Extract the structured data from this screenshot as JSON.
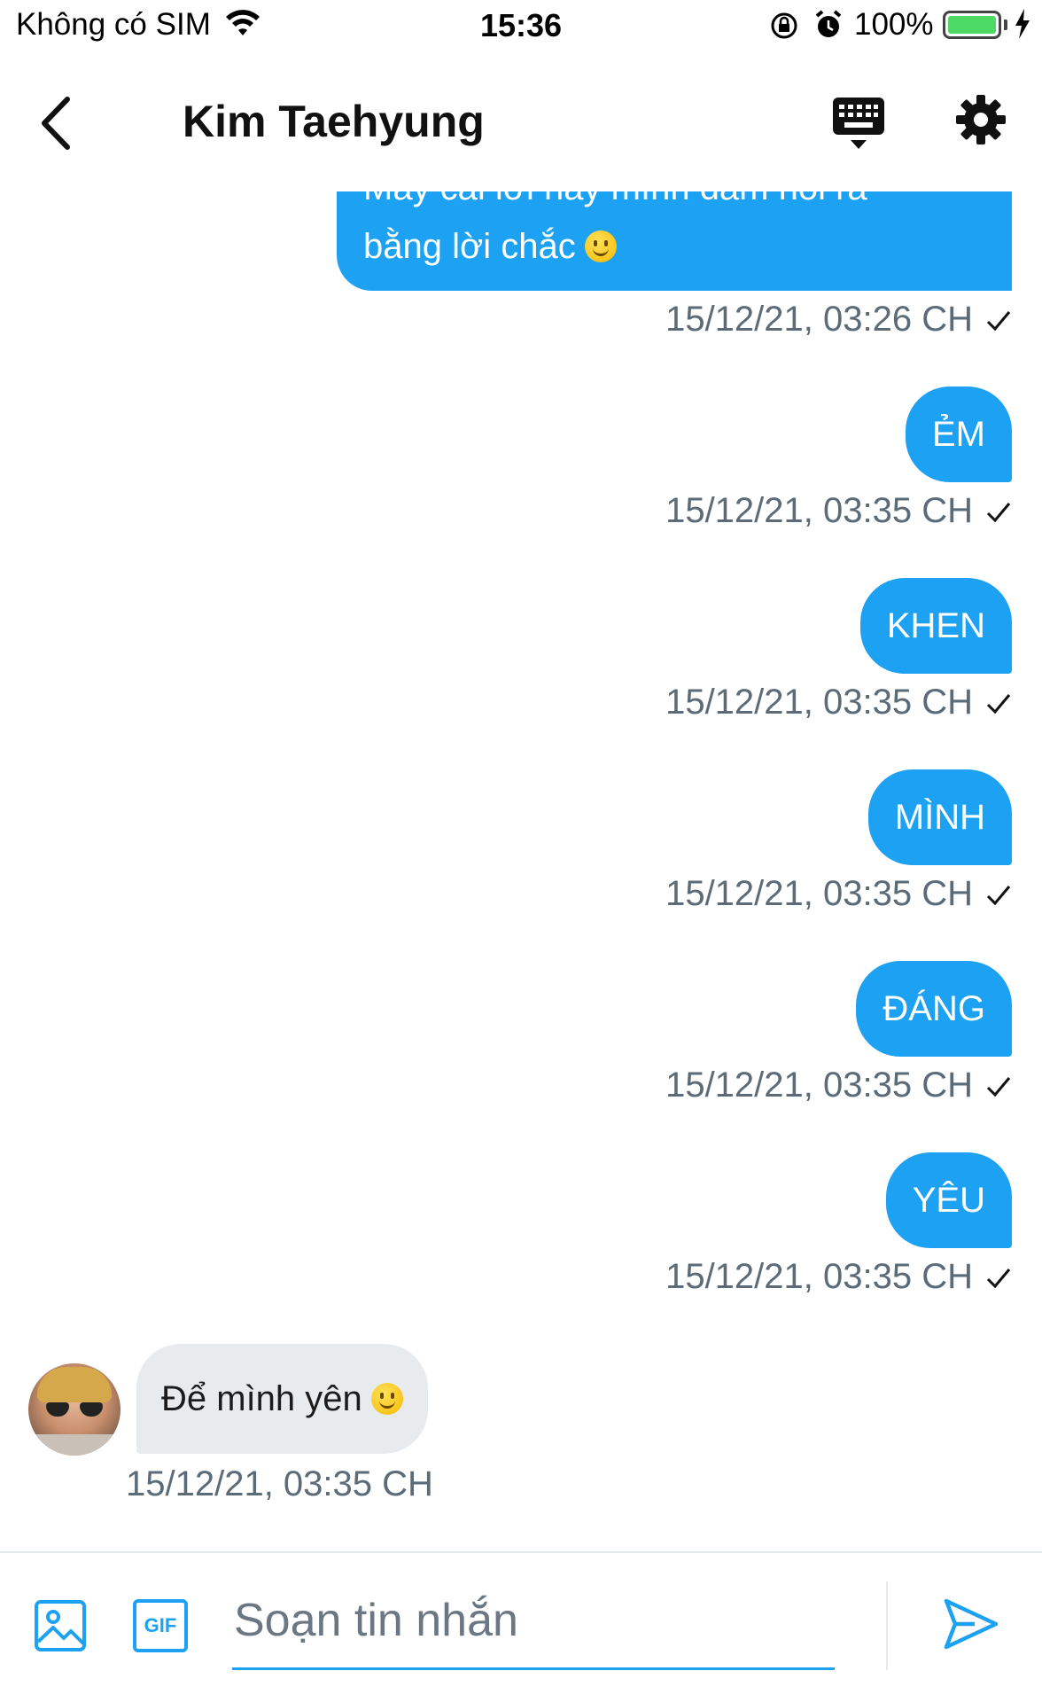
{
  "status_bar": {
    "carrier": "Không có SIM",
    "time": "15:36",
    "battery_percent": "100%",
    "battery_level": 1.0,
    "icons": [
      "wifi-icon",
      "rotation-lock-icon",
      "alarm-icon",
      "battery-icon",
      "charging-icon"
    ]
  },
  "header": {
    "title": "Kim Taehyung",
    "icons": [
      "back-chevron-icon",
      "keyboard-icon",
      "gear-icon"
    ]
  },
  "messages": {
    "first_partial": {
      "clipped_text": "Mấy cái lời hay mình dám nói ra",
      "text": "bằng lời chắc",
      "emoji": "slightly-smiling-face",
      "timestamp": "15/12/21, 03:26 CH"
    },
    "outgoing": [
      {
        "text": "ẺM",
        "timestamp": "15/12/21, 03:35 CH"
      },
      {
        "text": "KHEN",
        "timestamp": "15/12/21, 03:35 CH"
      },
      {
        "text": "MÌNH",
        "timestamp": "15/12/21, 03:35 CH"
      },
      {
        "text": "ĐÁNG",
        "timestamp": "15/12/21, 03:35 CH"
      },
      {
        "text": "YÊU",
        "timestamp": "15/12/21, 03:35 CH"
      }
    ],
    "incoming": {
      "text": "Để mình yên",
      "emoji": "slightly-smiling-face",
      "timestamp": "15/12/21, 03:35 CH"
    }
  },
  "composer": {
    "placeholder": "Soạn tin nhắn",
    "gif_label": "GIF",
    "icons": [
      "image-icon",
      "gif-icon",
      "send-icon"
    ]
  },
  "colors": {
    "accent": "#1da1f2",
    "incoming_bubble": "#e8ebee",
    "timestamp": "#5b6b78"
  }
}
